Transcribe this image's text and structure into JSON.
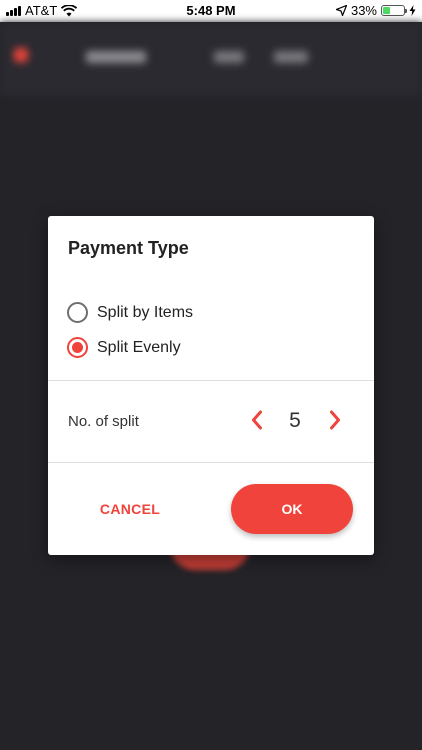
{
  "status_bar": {
    "carrier": "AT&T",
    "time": "5:48 PM",
    "battery_percent": "33%",
    "battery_level": 0.33,
    "icons": [
      "signal-icon",
      "wifi-icon",
      "location-arrow-icon",
      "battery-icon",
      "charging-bolt-icon"
    ]
  },
  "dialog": {
    "title": "Payment Type",
    "options": [
      {
        "label": "Split by Items",
        "selected": false
      },
      {
        "label": "Split Evenly",
        "selected": true
      }
    ],
    "split": {
      "label": "No. of split",
      "value": "5"
    },
    "cancel_label": "CANCEL",
    "ok_label": "OK"
  },
  "colors": {
    "accent": "#f0433b",
    "backdrop": "#232328"
  }
}
